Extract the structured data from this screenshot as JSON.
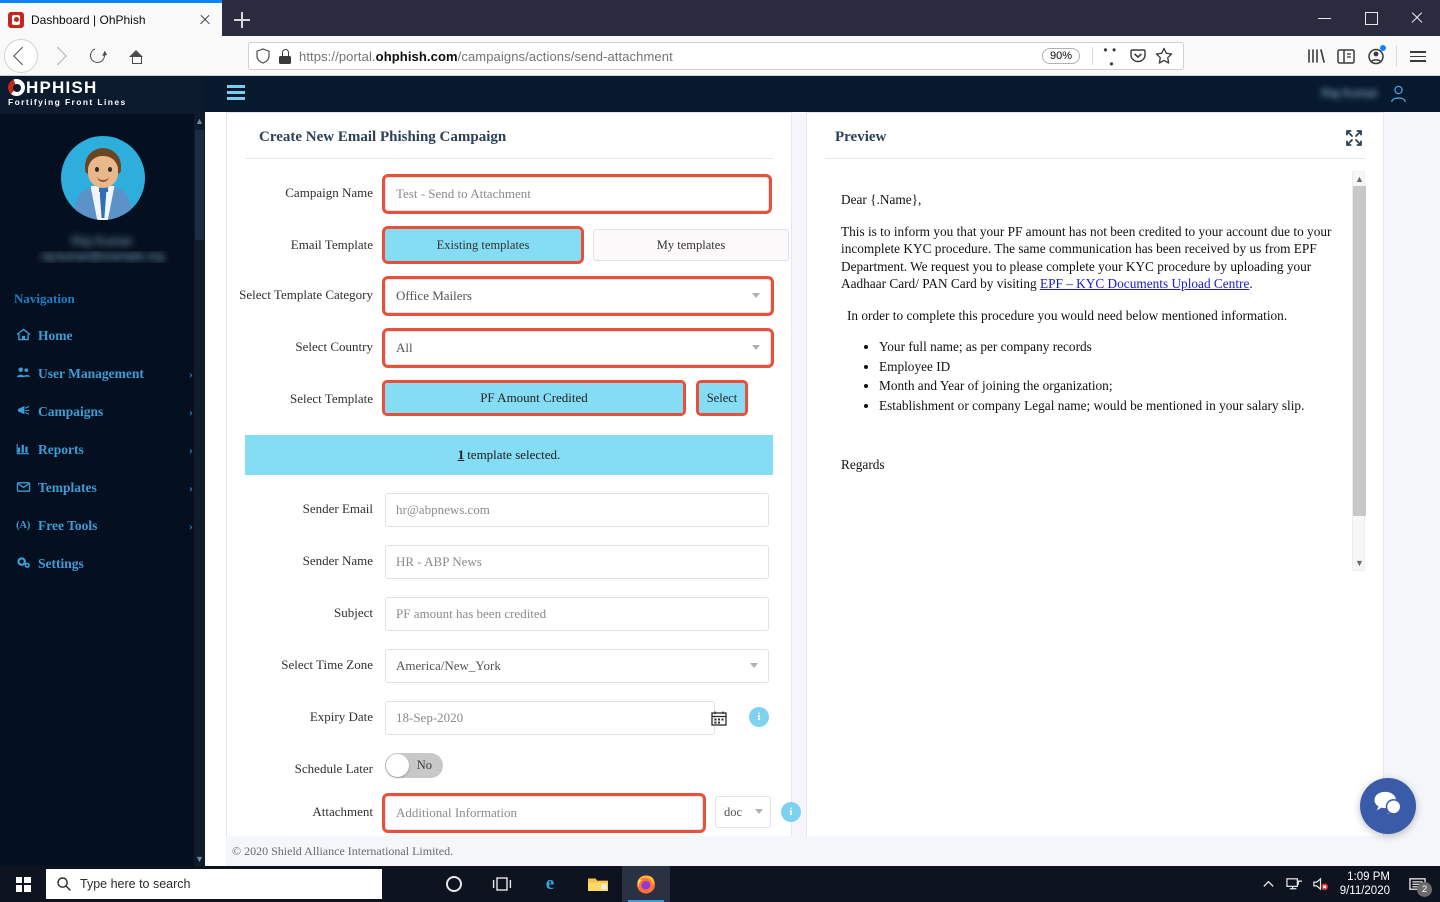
{
  "browser": {
    "tab": {
      "title": "Dashboard | OhPhish",
      "favicon": "ohphish-favicon"
    },
    "url_prefix": "https://portal.",
    "url_domain": "ohphish.com",
    "url_path": "/campaigns/actions/send-attachment",
    "zoom_level": "90%",
    "new_tab_label": "+",
    "controls": {
      "minimize": "minimize",
      "maximize": "maximize",
      "close": "close"
    }
  },
  "app": {
    "logo_word": "HPHISH",
    "logo_tagline": "Fortifying Front Lines",
    "profile_name": "Raj Kumar",
    "profile_email": "raj.kumar@example.org",
    "header_user": "Raj Kumar",
    "nav_heading": "Navigation",
    "nav_items": [
      {
        "label": "Home",
        "icon": "home-icon",
        "caret": ""
      },
      {
        "label": "User Management",
        "icon": "users-icon",
        "caret": "›"
      },
      {
        "label": "Campaigns",
        "icon": "megaphone-icon",
        "caret": "›"
      },
      {
        "label": "Reports",
        "icon": "chart-icon",
        "caret": "›"
      },
      {
        "label": "Templates",
        "icon": "envelope-icon",
        "caret": "›"
      },
      {
        "label": "Free Tools",
        "icon": "tools-icon",
        "caret": "›"
      },
      {
        "label": "Settings",
        "icon": "gear-icon",
        "caret": ""
      }
    ]
  },
  "form": {
    "title": "Create New Email Phishing Campaign",
    "campaign_name": {
      "label": "Campaign Name",
      "value": "Test - Send to Attachment",
      "placeholder": "Campaign Name"
    },
    "email_template": {
      "label": "Email Template",
      "tabs": [
        {
          "label": "Existing templates",
          "active": true
        },
        {
          "label": "My templates",
          "active": false
        }
      ]
    },
    "template_category": {
      "label": "Select Template Category",
      "value": "Office Mailers"
    },
    "country": {
      "label": "Select Country",
      "value": "All"
    },
    "template": {
      "label": "Select Template",
      "value": "PF Amount Credited",
      "button": "Select"
    },
    "selected_banner": {
      "count": "1",
      "text": "template selected."
    },
    "sender_email": {
      "label": "Sender Email",
      "value": "hr@abpnews.com"
    },
    "sender_name": {
      "label": "Sender Name",
      "value": "HR - ABP News"
    },
    "subject": {
      "label": "Subject",
      "value": "PF amount has been credited"
    },
    "timezone": {
      "label": "Select Time Zone",
      "value": "America/New_York"
    },
    "expiry_date": {
      "label": "Expiry Date",
      "value": "18-Sep-2020",
      "info": "i"
    },
    "schedule_later": {
      "label": "Schedule Later",
      "state": "No"
    },
    "attachment": {
      "label": "Attachment",
      "value": "Additional Information",
      "type": "doc",
      "info": "i"
    }
  },
  "preview": {
    "title": "Preview",
    "greeting": "Dear {.Name},",
    "paragraph1_a": "This is to inform you that your PF amount has not been credited to your account due to your incomplete KYC procedure. The same communication has been received by us from EPF Department. We request you to please complete your KYC procedure by uploading your Aadhaar Card/ PAN Card by visiting ",
    "link_text": "EPF – KYC Documents Upload Centre",
    "paragraph1_b": ".",
    "paragraph2": "In order to complete this procedure you would need below mentioned information.",
    "bullets": [
      "Your full name; as per company records",
      "Employee ID",
      "Month and Year of joining the organization;",
      "Establishment or company Legal name; would be mentioned in your salary slip."
    ],
    "signoff": "Regards"
  },
  "footer": {
    "copyright": "© 2020 Shield Alliance International Limited."
  },
  "taskbar": {
    "search_placeholder": "Type here to search",
    "time": "1:09 PM",
    "date": "9/11/2020",
    "notification_count": "2",
    "apps": [
      "cortana-icon",
      "task-view-icon",
      "edge-icon",
      "file-explorer-icon",
      "firefox-icon"
    ]
  },
  "colors": {
    "highlight_border": "#e8503a",
    "accent_cyan": "#85ddf5",
    "sidebar_bg": "#04101f",
    "nav_text": "#3e9bd6",
    "brand_red": "#c3261c",
    "link_blue": "#1a1ad6"
  }
}
